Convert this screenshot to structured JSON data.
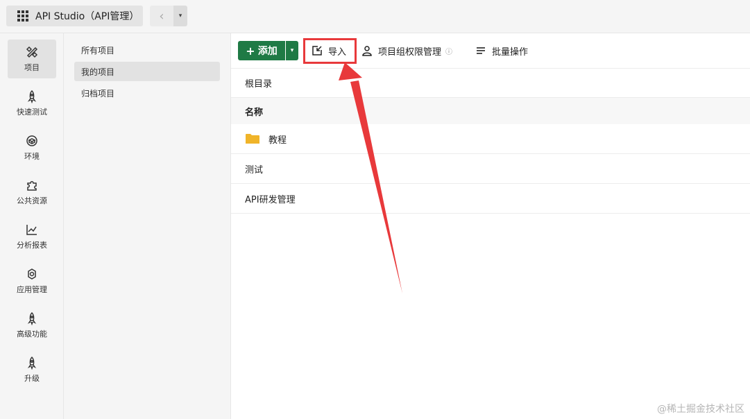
{
  "topbar": {
    "app_title": "API Studio（API管理）",
    "back_glyph": "‹",
    "drop_glyph": "▾"
  },
  "sidebar": {
    "items": [
      {
        "label": "项目",
        "icon": "project-icon",
        "active": true
      },
      {
        "label": "快速测试",
        "icon": "rocket-icon",
        "active": false
      },
      {
        "label": "环境",
        "icon": "cube-icon",
        "active": false
      },
      {
        "label": "公共资源",
        "icon": "puzzle-icon",
        "active": false
      },
      {
        "label": "分析报表",
        "icon": "chart-icon",
        "active": false
      },
      {
        "label": "应用管理",
        "icon": "gear-icon",
        "active": false
      },
      {
        "label": "高级功能",
        "icon": "rocket-icon",
        "active": false
      },
      {
        "label": "升级",
        "icon": "rocket-icon",
        "active": false
      }
    ]
  },
  "subnav": {
    "items": [
      {
        "label": "所有项目",
        "active": false
      },
      {
        "label": "我的项目",
        "active": true
      },
      {
        "label": "归档项目",
        "active": false
      }
    ]
  },
  "toolbar": {
    "add_label": "添加",
    "add_glyph": "+",
    "add_drop_glyph": "▾",
    "import_label": "导入",
    "permissions_label": "项目组权限管理",
    "permissions_info_glyph": "ⓘ",
    "batch_label": "批量操作"
  },
  "breadcrumb": {
    "root": "根目录"
  },
  "table": {
    "header_name": "名称",
    "rows": [
      {
        "name": "教程",
        "type": "folder"
      },
      {
        "name": "测试",
        "type": "item"
      },
      {
        "name": "API研发管理",
        "type": "item"
      }
    ]
  },
  "colors": {
    "accent_green": "#1f7a45",
    "highlight_red": "#e8393b",
    "folder_yellow": "#f0b429"
  },
  "watermark": "@稀土掘金技术社区"
}
